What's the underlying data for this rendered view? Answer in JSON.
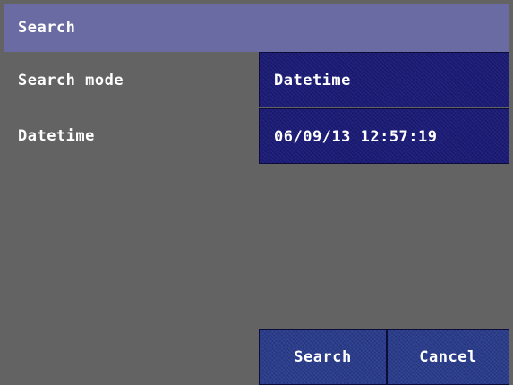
{
  "dialog": {
    "title": "Search"
  },
  "fields": {
    "search_mode": {
      "label": "Search mode",
      "value": "Datetime"
    },
    "datetime": {
      "label": "Datetime",
      "value": "06/09/13 12:57:19"
    }
  },
  "buttons": {
    "search_label": "Search",
    "cancel_label": "Cancel"
  },
  "colors": {
    "background": "#636363",
    "title_bar": "#6b6ba3",
    "value_box": "#1b1b78",
    "button": "#2a3c8c",
    "text": "#ffffff"
  }
}
